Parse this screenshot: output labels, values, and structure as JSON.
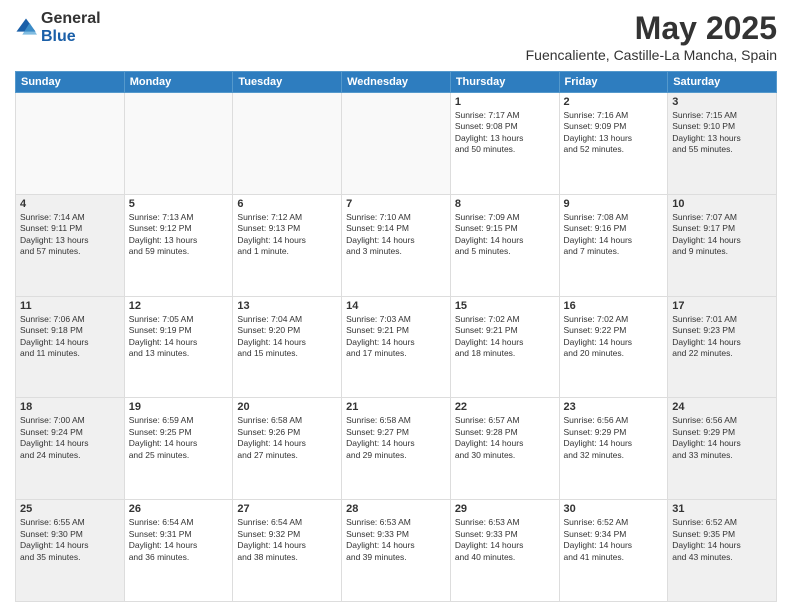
{
  "logo": {
    "general": "General",
    "blue": "Blue"
  },
  "title": "May 2025",
  "location": "Fuencaliente, Castille-La Mancha, Spain",
  "headers": [
    "Sunday",
    "Monday",
    "Tuesday",
    "Wednesday",
    "Thursday",
    "Friday",
    "Saturday"
  ],
  "weeks": [
    [
      {
        "day": "",
        "info": ""
      },
      {
        "day": "",
        "info": ""
      },
      {
        "day": "",
        "info": ""
      },
      {
        "day": "",
        "info": ""
      },
      {
        "day": "1",
        "info": "Sunrise: 7:17 AM\nSunset: 9:08 PM\nDaylight: 13 hours\nand 50 minutes."
      },
      {
        "day": "2",
        "info": "Sunrise: 7:16 AM\nSunset: 9:09 PM\nDaylight: 13 hours\nand 52 minutes."
      },
      {
        "day": "3",
        "info": "Sunrise: 7:15 AM\nSunset: 9:10 PM\nDaylight: 13 hours\nand 55 minutes."
      }
    ],
    [
      {
        "day": "4",
        "info": "Sunrise: 7:14 AM\nSunset: 9:11 PM\nDaylight: 13 hours\nand 57 minutes."
      },
      {
        "day": "5",
        "info": "Sunrise: 7:13 AM\nSunset: 9:12 PM\nDaylight: 13 hours\nand 59 minutes."
      },
      {
        "day": "6",
        "info": "Sunrise: 7:12 AM\nSunset: 9:13 PM\nDaylight: 14 hours\nand 1 minute."
      },
      {
        "day": "7",
        "info": "Sunrise: 7:10 AM\nSunset: 9:14 PM\nDaylight: 14 hours\nand 3 minutes."
      },
      {
        "day": "8",
        "info": "Sunrise: 7:09 AM\nSunset: 9:15 PM\nDaylight: 14 hours\nand 5 minutes."
      },
      {
        "day": "9",
        "info": "Sunrise: 7:08 AM\nSunset: 9:16 PM\nDaylight: 14 hours\nand 7 minutes."
      },
      {
        "day": "10",
        "info": "Sunrise: 7:07 AM\nSunset: 9:17 PM\nDaylight: 14 hours\nand 9 minutes."
      }
    ],
    [
      {
        "day": "11",
        "info": "Sunrise: 7:06 AM\nSunset: 9:18 PM\nDaylight: 14 hours\nand 11 minutes."
      },
      {
        "day": "12",
        "info": "Sunrise: 7:05 AM\nSunset: 9:19 PM\nDaylight: 14 hours\nand 13 minutes."
      },
      {
        "day": "13",
        "info": "Sunrise: 7:04 AM\nSunset: 9:20 PM\nDaylight: 14 hours\nand 15 minutes."
      },
      {
        "day": "14",
        "info": "Sunrise: 7:03 AM\nSunset: 9:21 PM\nDaylight: 14 hours\nand 17 minutes."
      },
      {
        "day": "15",
        "info": "Sunrise: 7:02 AM\nSunset: 9:21 PM\nDaylight: 14 hours\nand 18 minutes."
      },
      {
        "day": "16",
        "info": "Sunrise: 7:02 AM\nSunset: 9:22 PM\nDaylight: 14 hours\nand 20 minutes."
      },
      {
        "day": "17",
        "info": "Sunrise: 7:01 AM\nSunset: 9:23 PM\nDaylight: 14 hours\nand 22 minutes."
      }
    ],
    [
      {
        "day": "18",
        "info": "Sunrise: 7:00 AM\nSunset: 9:24 PM\nDaylight: 14 hours\nand 24 minutes."
      },
      {
        "day": "19",
        "info": "Sunrise: 6:59 AM\nSunset: 9:25 PM\nDaylight: 14 hours\nand 25 minutes."
      },
      {
        "day": "20",
        "info": "Sunrise: 6:58 AM\nSunset: 9:26 PM\nDaylight: 14 hours\nand 27 minutes."
      },
      {
        "day": "21",
        "info": "Sunrise: 6:58 AM\nSunset: 9:27 PM\nDaylight: 14 hours\nand 29 minutes."
      },
      {
        "day": "22",
        "info": "Sunrise: 6:57 AM\nSunset: 9:28 PM\nDaylight: 14 hours\nand 30 minutes."
      },
      {
        "day": "23",
        "info": "Sunrise: 6:56 AM\nSunset: 9:29 PM\nDaylight: 14 hours\nand 32 minutes."
      },
      {
        "day": "24",
        "info": "Sunrise: 6:56 AM\nSunset: 9:29 PM\nDaylight: 14 hours\nand 33 minutes."
      }
    ],
    [
      {
        "day": "25",
        "info": "Sunrise: 6:55 AM\nSunset: 9:30 PM\nDaylight: 14 hours\nand 35 minutes."
      },
      {
        "day": "26",
        "info": "Sunrise: 6:54 AM\nSunset: 9:31 PM\nDaylight: 14 hours\nand 36 minutes."
      },
      {
        "day": "27",
        "info": "Sunrise: 6:54 AM\nSunset: 9:32 PM\nDaylight: 14 hours\nand 38 minutes."
      },
      {
        "day": "28",
        "info": "Sunrise: 6:53 AM\nSunset: 9:33 PM\nDaylight: 14 hours\nand 39 minutes."
      },
      {
        "day": "29",
        "info": "Sunrise: 6:53 AM\nSunset: 9:33 PM\nDaylight: 14 hours\nand 40 minutes."
      },
      {
        "day": "30",
        "info": "Sunrise: 6:52 AM\nSunset: 9:34 PM\nDaylight: 14 hours\nand 41 minutes."
      },
      {
        "day": "31",
        "info": "Sunrise: 6:52 AM\nSunset: 9:35 PM\nDaylight: 14 hours\nand 43 minutes."
      }
    ]
  ]
}
